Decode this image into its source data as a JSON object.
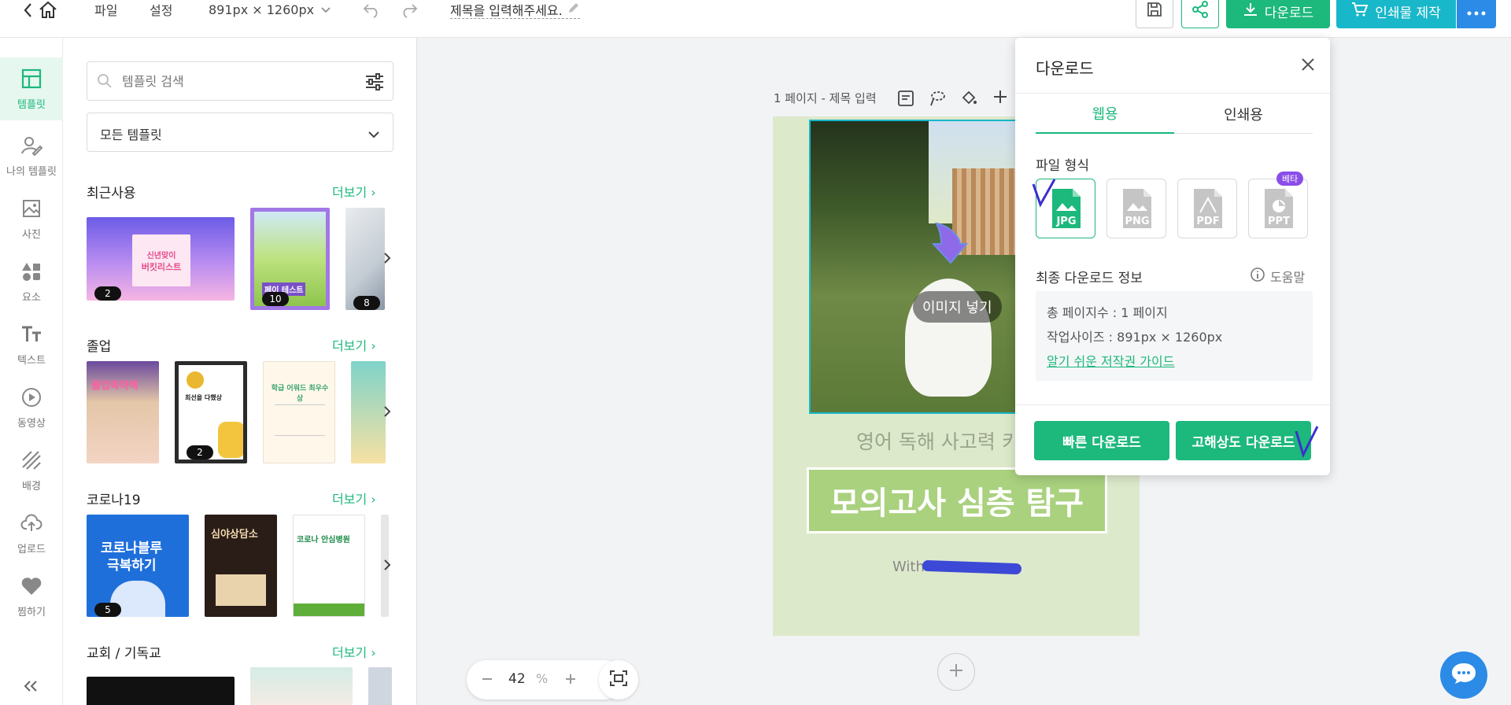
{
  "topbar": {
    "menu_file": "파일",
    "menu_settings": "설정",
    "size_label": "891px × 1260px",
    "title": "제목을 입력해주세요.",
    "download_label": "다운로드",
    "print_label": "인쇄물 제작"
  },
  "sidebar": {
    "items": [
      {
        "label": "템플릿",
        "icon": "template-icon"
      },
      {
        "label": "나의 템플릿",
        "icon": "my-template-icon"
      },
      {
        "label": "사진",
        "icon": "photo-icon"
      },
      {
        "label": "요소",
        "icon": "element-icon"
      },
      {
        "label": "텍스트",
        "icon": "text-icon"
      },
      {
        "label": "동영상",
        "icon": "video-icon"
      },
      {
        "label": "배경",
        "icon": "background-icon"
      },
      {
        "label": "업로드",
        "icon": "upload-icon"
      },
      {
        "label": "찜하기",
        "icon": "heart-icon"
      }
    ]
  },
  "panel": {
    "search_placeholder": "템플릿 검색",
    "select_value": "모든 템플릿",
    "more_label": "더보기",
    "sections": [
      {
        "title": "최근사용",
        "badges": [
          "2",
          "10",
          "8"
        ],
        "thumb_texts": [
          "신년맞이",
          "버킷리스트",
          "페이 테스트"
        ]
      },
      {
        "title": "졸업",
        "badges": [
          "",
          "2",
          "",
          ""
        ],
        "thumb_texts": [
          "졸업축하해",
          "최선을 다했상",
          "학급 어워드 최우수상"
        ]
      },
      {
        "title": "코로나19",
        "badges": [
          "5",
          "",
          ""
        ],
        "thumb_texts": [
          "코로나블루",
          "극복하기",
          "심야상담소",
          "코로나 안심병원"
        ]
      },
      {
        "title": "교회 / 기독교"
      }
    ]
  },
  "canvas": {
    "page_label": "1 페이지 - 제목 입력",
    "insert_image_label": "이미지 넣기",
    "subtitle": "영어 독해 사고력 키",
    "headline": "모의고사 심층 탐구",
    "with_text": "With",
    "zoom_value": "42",
    "zoom_unit": "%"
  },
  "download_modal": {
    "title": "다운로드",
    "tab_web": "웹용",
    "tab_print": "인쇄용",
    "file_format_label": "파일 형식",
    "formats": [
      "JPG",
      "PNG",
      "PDF",
      "PPT"
    ],
    "beta_badge": "베타",
    "final_info_label": "최종 다운로드 정보",
    "help_label": "도움말",
    "total_pages": "총 페이지수 : 1 페이지",
    "work_size": "작업사이즈 : 891px × 1260px",
    "copyright_link": "알기 쉬운 저작권 가이드",
    "fast_download": "빠른 다운로드",
    "hq_download": "고해상도 다운로드"
  },
  "colors": {
    "brand_green": "#1cb87c",
    "teal": "#18b7c9",
    "blue": "#2b8be6",
    "canvas_green": "#dde9cb",
    "headline_green": "#a9d17e",
    "purple_badge": "#8a4de8"
  }
}
